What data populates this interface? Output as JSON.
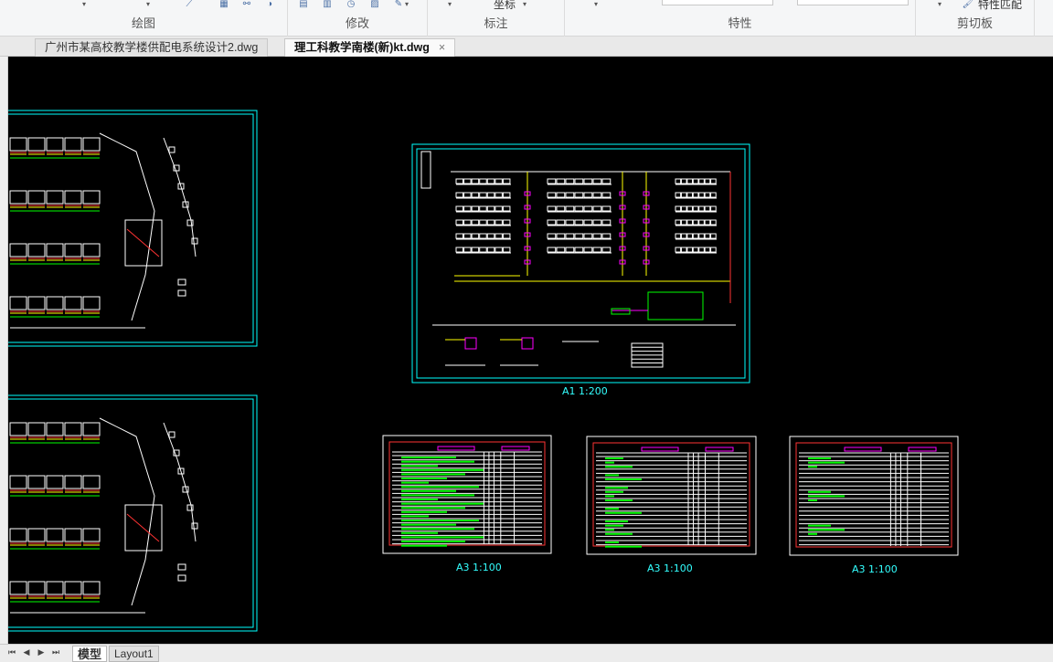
{
  "ribbon": {
    "panels": [
      {
        "title": "绘图"
      },
      {
        "title": "修改"
      },
      {
        "title": "标注"
      },
      {
        "title": "特性"
      },
      {
        "title": "剪切板"
      }
    ],
    "annotate_item": "坐标",
    "match_properties": "特性匹配"
  },
  "tabs": [
    {
      "label": "广州市某高校教学楼供配电系统设计2.dwg"
    },
    {
      "label": "理工科教学南楼(新)kt.dwg",
      "close": "×"
    }
  ],
  "canvas": {
    "background": "#000000",
    "frame_color": "#00ffff",
    "sheets": [
      {
        "scale": "A1 1:200"
      },
      {
        "scale": "A3 1:100"
      },
      {
        "scale": "A3 1:100"
      },
      {
        "scale": "A3 1:100"
      }
    ]
  },
  "layout_tabs": [
    {
      "label": "模型"
    },
    {
      "label": "Layout1"
    }
  ],
  "nav": {
    "first": "⏮",
    "prev": "◀",
    "next": "▶",
    "last": "⏭"
  }
}
